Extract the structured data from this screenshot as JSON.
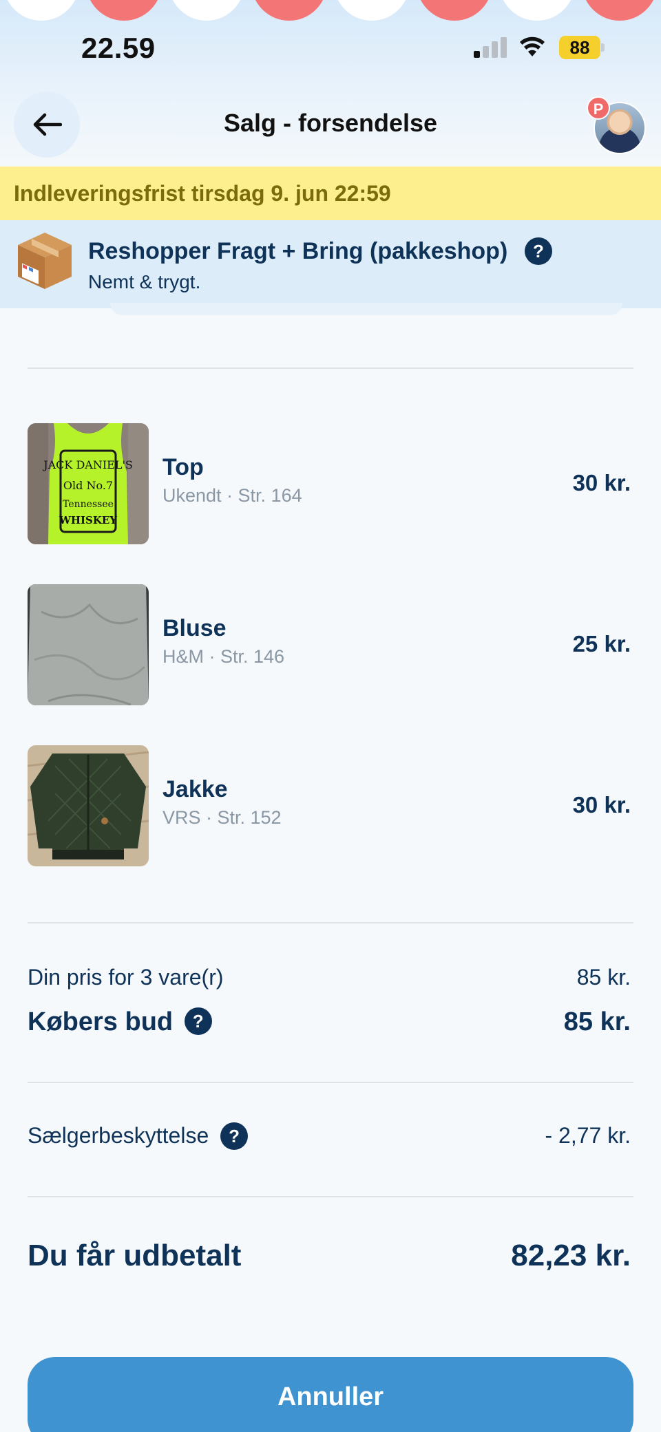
{
  "status_bar": {
    "time": "22.59",
    "battery": "88"
  },
  "nav": {
    "title": "Salg - forsendelse",
    "avatar_badge": "P"
  },
  "deadline": {
    "text": "Indleveringsfrist tirsdag 9. jun 22:59"
  },
  "shipping": {
    "title": "Reshopper Fragt + Bring (pakkeshop)",
    "subtitle": "Nemt & trygt.",
    "help": "?"
  },
  "items": [
    {
      "name": "Top",
      "meta": "Ukendt · Str. 164",
      "price": "30 kr."
    },
    {
      "name": "Bluse",
      "meta": "H&M · Str. 146",
      "price": "25 kr."
    },
    {
      "name": "Jakke",
      "meta": "VRS · Str. 152",
      "price": "30 kr."
    }
  ],
  "summary": {
    "your_price_label": "Din pris for 3 vare(r)",
    "your_price_value": "85 kr.",
    "buyer_bid_label": "Købers bud",
    "buyer_bid_value": "85 kr.",
    "seller_protection_label": "Sælgerbeskyttelse",
    "seller_protection_value": "- 2,77 kr.",
    "payout_label": "Du får udbetalt",
    "payout_value": "82,23 kr.",
    "help": "?"
  },
  "actions": {
    "cancel_label": "Annuller"
  },
  "colors": {
    "primary_text": "#0e3258",
    "button": "#3f93d1",
    "deadline_bg": "#fdef8e",
    "deadline_text": "#7b6b0c",
    "shipping_bg": "#dcecf8"
  },
  "icons": {
    "back": "arrow-left-icon",
    "package": "package-box-icon",
    "help": "question-mark-icon"
  }
}
